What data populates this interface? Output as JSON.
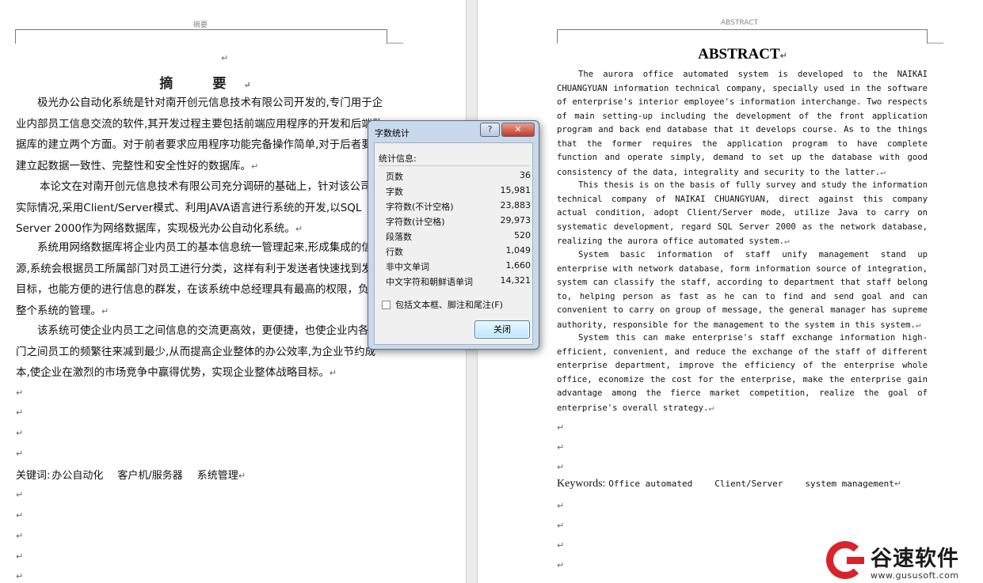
{
  "left_page": {
    "header_label": "摘要",
    "title": "摘 要",
    "paragraphs": [
      "极光办公自动化系统是针对南开创元信息技术有限公司开发的,专门用于企业内部员工信息交流的软件,其开发过程主要包括前端应用程序的开发和后端数据库的建立两个方面。对于前者要求应用程序功能完备操作简单,对于后者要求建立起数据一致性、完整性和安全性好的数据库。",
      "本论文在对南开创元信息技术有限公司充分调研的基础上，针对该公司的实际情况,采用Client/Server模式、利用JAVA语言进行系统的开发,以SQL Server 2000作为网络数据库，实现极光办公自动化系统。",
      "系统用网络数据库将企业内员工的基本信息统一管理起来,形成集成的信息源,系统会根据员工所属部门对员工进行分类，这样有利于发送者快速找到发送目标，也能方便的进行信息的群发，在该系统中总经理具有最高的权限，负责整个系统的管理。",
      "该系统可使企业内员工之间信息的交流更高效，更便捷，也使企业内各部门之间员工的频繁往来减到最少,从而提高企业整体的办公效率,为企业节约成本,使企业在激烈的市场竞争中赢得优势，实现企业整体战略目标。"
    ],
    "keywords_label": "关键词:",
    "keywords": [
      "办公自动化",
      "客户机/服务器",
      "系统管理"
    ]
  },
  "right_page": {
    "header_label": "ABSTRACT",
    "title": "ABSTRACT",
    "paragraphs": [
      "The aurora office automated system is developed to the NAIKAI CHUANGYUAN information technical company, specially used in the software of enterprise's interior employee's information interchange. Two respects of main setting-up including the development of the front application program and back end database that it develops course. As to the things that the former requires the application program to have complete function and operate simply, demand to set up the database with good consistency of the data, integrality and security to the latter.",
      "This thesis is on the basis of fully survey and study the information technical company of NAIKAI CHUANGYUAN, direct against this company actual condition, adopt Client/Server mode, utilize Java to carry on systematic development, regard SQL Server 2000 as the network database, realizing the aurora office automated system.",
      "System basic information of staff unify management stand up enterprise with network database, form information source of integration, system can classify the staff, according to department that staff belong to, helping person as fast as he can to find and send goal and can convenient to carry on group of message, the general manager has supreme authority, responsible for the management to the system in this system.",
      "System this can make enterprise's staff exchange information high-efficient, convenient, and reduce the exchange of the staff of different enterprise department, improve the efficiency of the enterprise whole office, economize the cost for the enterprise, make the enterprise gain advantage among the fierce market competition, realize the goal of enterprise's overall strategy."
    ],
    "keywords_label": "Keywords:",
    "keywords": [
      "Office automated",
      "Client/Server",
      "system management"
    ]
  },
  "dialog": {
    "title": "字数统计",
    "help_glyph": "?",
    "close_glyph": "✕",
    "section_label": "统计信息:",
    "stats": [
      {
        "label": "页数",
        "value": "36"
      },
      {
        "label": "字数",
        "value": "15,981"
      },
      {
        "label": "字符数(不计空格)",
        "value": "23,883"
      },
      {
        "label": "字符数(计空格)",
        "value": "29,973"
      },
      {
        "label": "段落数",
        "value": "520"
      },
      {
        "label": "行数",
        "value": "1,049"
      },
      {
        "label": "非中文单词",
        "value": "1,660"
      },
      {
        "label": "中文字符和朝鲜语单词",
        "value": "14,321"
      }
    ],
    "checkbox_label": "包括文本框、脚注和尾注(F)",
    "checkbox_checked": false,
    "close_button": "关闭"
  },
  "watermark": {
    "text": "谷速软件",
    "url": "www.gususoft.com",
    "color": "#d8232a"
  },
  "paragraph_mark": "↵"
}
